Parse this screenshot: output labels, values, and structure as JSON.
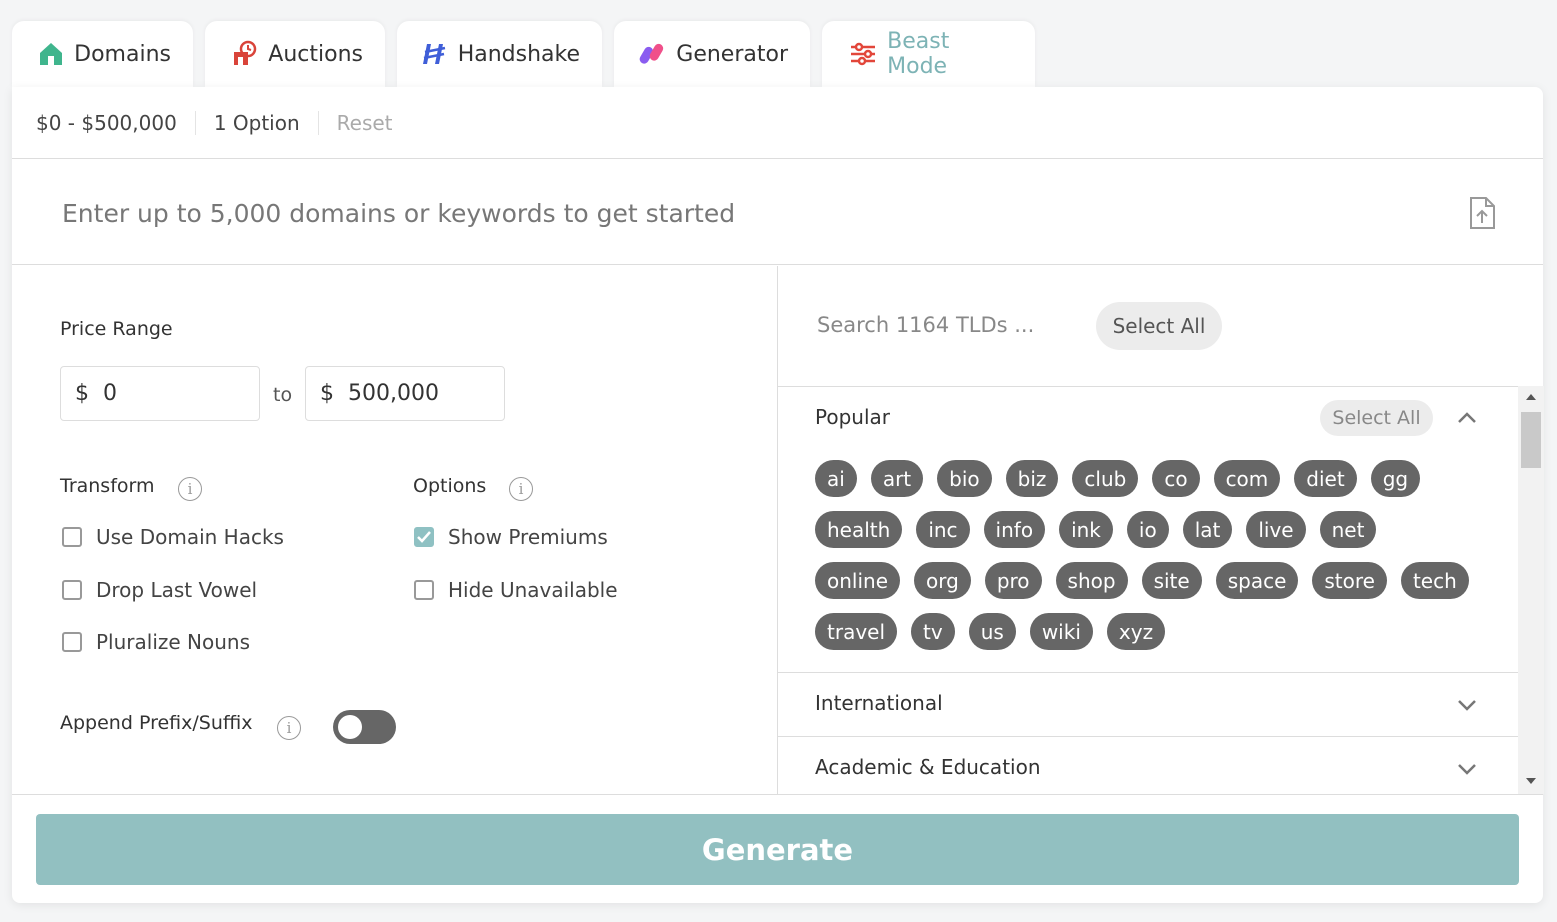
{
  "tabs": [
    {
      "label": "Domains",
      "icon": "house-icon",
      "color": "#3fb58d"
    },
    {
      "label": "Auctions",
      "icon": "auction-icon",
      "color": "#d9443a"
    },
    {
      "label": "Handshake",
      "icon": "handshake-icon",
      "color": "#3f5ed8"
    },
    {
      "label": "Generator",
      "icon": "generator-icon",
      "color": "#8a5cf0"
    },
    {
      "label": "Beast Mode",
      "icon": "sliders-icon",
      "color": "#e2463a",
      "active": true
    }
  ],
  "filters": {
    "price": "$0 - $500,000",
    "options": "1 Option",
    "reset": "Reset"
  },
  "entry": {
    "placeholder": "Enter up to 5,000 domains or keywords to get started"
  },
  "price_range": {
    "label": "Price Range",
    "currency": "$",
    "min": "0",
    "to": "to",
    "max": "500,000"
  },
  "transform": {
    "label": "Transform",
    "items": [
      "Use Domain Hacks",
      "Drop Last Vowel",
      "Pluralize Nouns"
    ]
  },
  "options": {
    "label": "Options",
    "items": [
      {
        "label": "Show Premiums",
        "checked": true
      },
      {
        "label": "Hide Unavailable",
        "checked": false
      }
    ]
  },
  "append": {
    "label": "Append Prefix/Suffix",
    "enabled": false
  },
  "tlds": {
    "search_placeholder": "Search 1164 TLDs ...",
    "select_all": "Select All",
    "popular": {
      "title": "Popular",
      "select_all": "Select All",
      "chips": [
        "ai",
        "art",
        "bio",
        "biz",
        "club",
        "co",
        "com",
        "diet",
        "gg",
        "health",
        "inc",
        "info",
        "ink",
        "io",
        "lat",
        "live",
        "net",
        "online",
        "org",
        "pro",
        "shop",
        "site",
        "space",
        "store",
        "tech",
        "travel",
        "tv",
        "us",
        "wiki",
        "xyz"
      ]
    },
    "international": {
      "title": "International"
    },
    "academic": {
      "title": "Academic & Education"
    }
  },
  "generate": {
    "label": "Generate",
    "color": "#92c0c1"
  }
}
